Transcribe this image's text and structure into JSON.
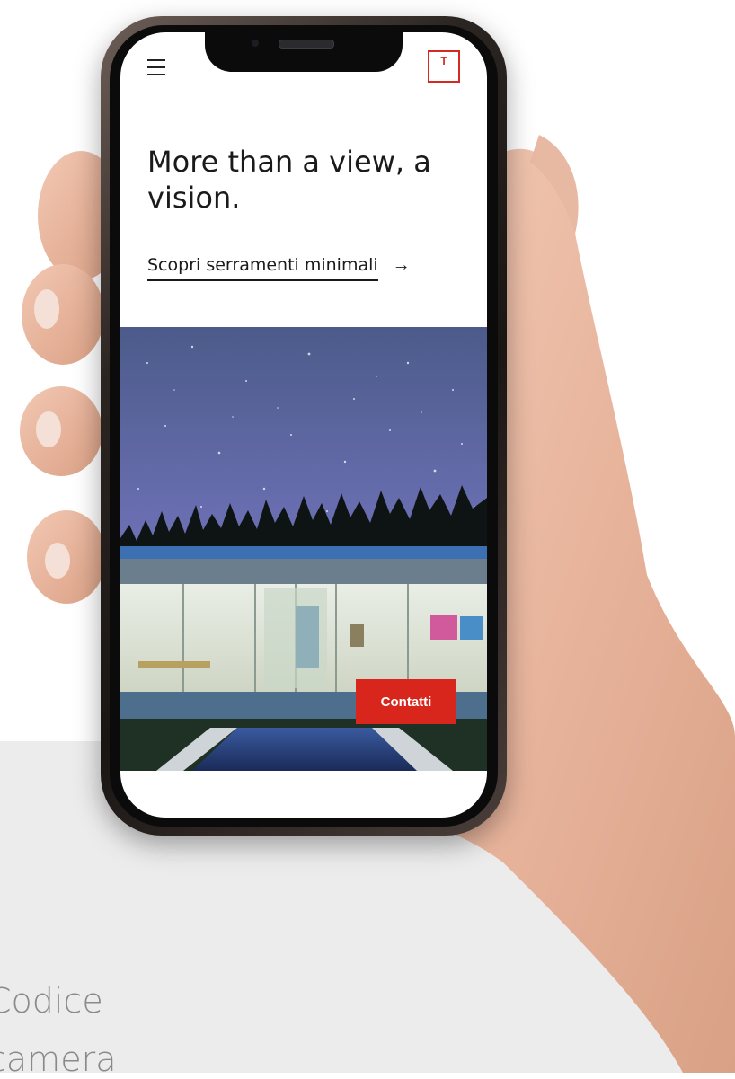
{
  "background": {
    "line1": "Codice",
    "line2": "camera"
  },
  "app": {
    "menu_icon": "hamburger-menu-icon",
    "logo_letter": "T",
    "headline": "More than a view, a vision.",
    "cta_label": "Scopri serramenti minimali",
    "cta_arrow": "→",
    "contact_label": "Contatti"
  },
  "colors": {
    "brand_red": "#d9261c",
    "text": "#1a1a1a",
    "panel": "#ececec"
  }
}
